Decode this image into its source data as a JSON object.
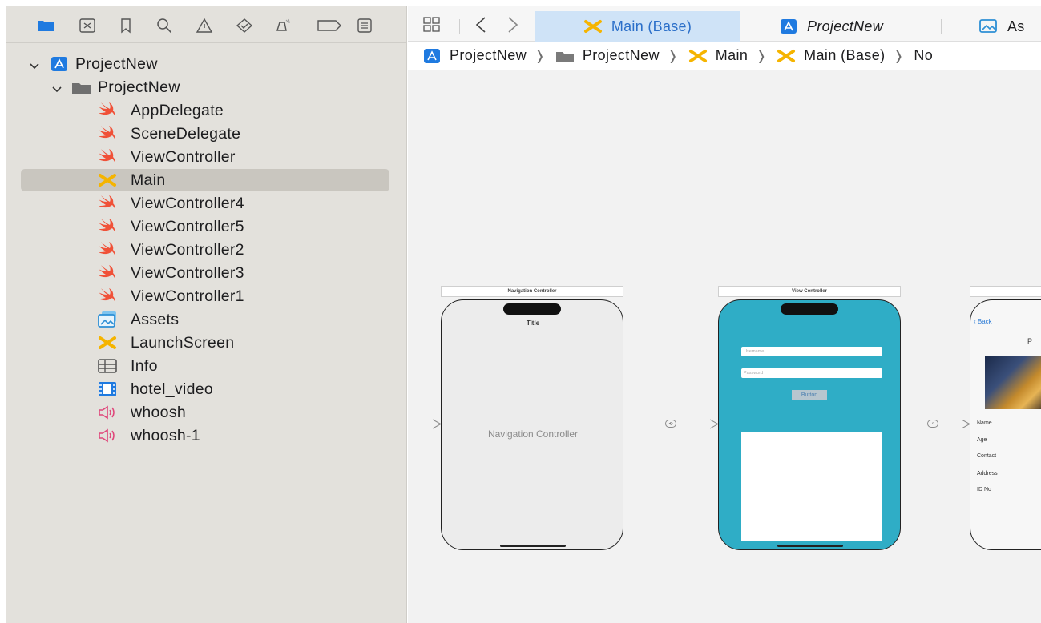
{
  "navigator": {
    "toolbar_icons": [
      "folder-icon",
      "source-control-icon",
      "bookmark-icon",
      "find-icon",
      "issue-icon",
      "test-icon",
      "debug-icon",
      "breakpoint-icon",
      "report-icon"
    ],
    "tree": [
      {
        "label": "ProjectNew",
        "icon": "project-icon",
        "expanded": true,
        "level": 0
      },
      {
        "label": "ProjectNew",
        "icon": "folder-icon",
        "expanded": true,
        "level": 1
      },
      {
        "label": "AppDelegate",
        "icon": "swift-icon",
        "level": 2
      },
      {
        "label": "SceneDelegate",
        "icon": "swift-icon",
        "level": 2
      },
      {
        "label": "ViewController",
        "icon": "swift-icon",
        "level": 2
      },
      {
        "label": "Main",
        "icon": "storyboard-icon",
        "level": 2,
        "selected": true
      },
      {
        "label": "ViewController4",
        "icon": "swift-icon",
        "level": 2
      },
      {
        "label": "ViewController5",
        "icon": "swift-icon",
        "level": 2
      },
      {
        "label": "ViewController2",
        "icon": "swift-icon",
        "level": 2
      },
      {
        "label": "ViewController3",
        "icon": "swift-icon",
        "level": 2
      },
      {
        "label": "ViewController1",
        "icon": "swift-icon",
        "level": 2
      },
      {
        "label": "Assets",
        "icon": "assets-icon",
        "level": 2
      },
      {
        "label": "LaunchScreen",
        "icon": "storyboard-icon",
        "level": 2
      },
      {
        "label": "Info",
        "icon": "plist-icon",
        "level": 2
      },
      {
        "label": "hotel_video",
        "icon": "video-icon",
        "level": 2
      },
      {
        "label": "whoosh",
        "icon": "audio-icon",
        "level": 2
      },
      {
        "label": "whoosh-1",
        "icon": "audio-icon",
        "level": 2
      }
    ]
  },
  "tabs": [
    {
      "label": "Main (Base)",
      "icon": "storyboard-icon",
      "active": true
    },
    {
      "label": "ProjectNew",
      "icon": "project-icon",
      "italic": true
    },
    {
      "label": "As",
      "icon": "assets-icon"
    }
  ],
  "jumpbar": [
    {
      "label": "ProjectNew",
      "icon": "project-icon"
    },
    {
      "label": "ProjectNew",
      "icon": "folder-icon"
    },
    {
      "label": "Main",
      "icon": "storyboard-icon"
    },
    {
      "label": "Main (Base)",
      "icon": "storyboard-icon"
    },
    {
      "label": "No",
      "icon": ""
    }
  ],
  "canvas": {
    "nav_scene": {
      "title": "Navigation Controller",
      "nav_title": "Title",
      "center_label": "Navigation Controller"
    },
    "vc_scene": {
      "title": "View Controller",
      "username_placeholder": "Username",
      "password_placeholder": "Password",
      "button_label": "Button",
      "bg_color": "#2fadc6"
    },
    "detail_scene": {
      "back_label": "Back",
      "header_letter": "P",
      "fields": [
        "Name",
        "Age",
        "Contact",
        "Address",
        "ID No"
      ]
    }
  },
  "colors": {
    "accent": "#2b6fc9",
    "swift": "#f05138",
    "storyboard": "#f5b400",
    "project": "#1f7ae0",
    "audio": "#e0467a",
    "selection": "#c9c6bf"
  }
}
